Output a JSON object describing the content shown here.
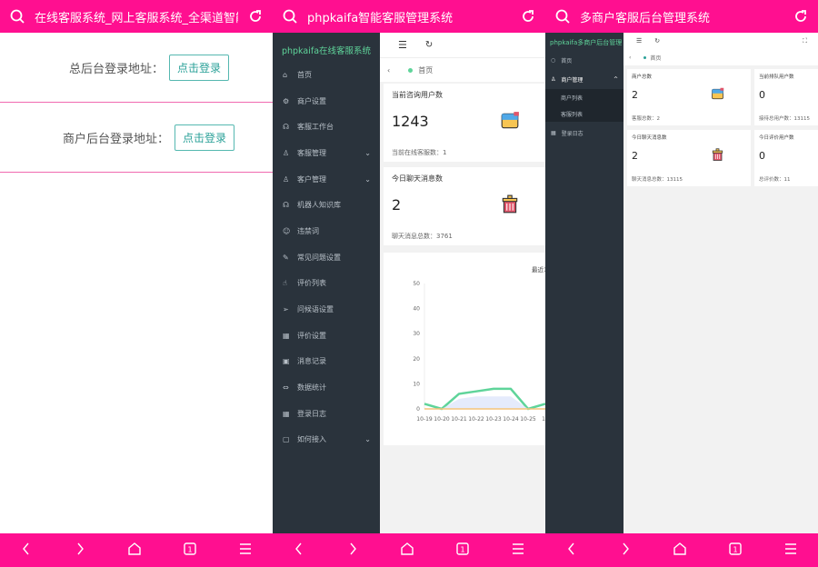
{
  "theme": {
    "browser_bar": "#ff0f90",
    "sidebar": "#2a333c",
    "accent_green": "#5fd49a",
    "button_teal": "#2aa198"
  },
  "p1": {
    "title": "在线客服系统_网上客服系统_全渠道智能客服系统",
    "rows": [
      {
        "label": "总后台登录地址：",
        "button": "点击登录"
      },
      {
        "label": "商户后台登录地址：",
        "button": "点击登录"
      }
    ]
  },
  "p2": {
    "title": "phpkaifa智能客服管理系统",
    "logo": "phpkaifa在线客服系统",
    "breadcrumb": "首页",
    "menu": [
      {
        "label": "首页",
        "icon": "home-icon"
      },
      {
        "label": "商户设置",
        "icon": "gear-icon"
      },
      {
        "label": "客服工作台",
        "icon": "headset-icon"
      },
      {
        "label": "客服管理",
        "icon": "user-icon",
        "arrow": true
      },
      {
        "label": "客户管理",
        "icon": "users-icon",
        "arrow": true
      },
      {
        "label": "机器人知识库",
        "icon": "robot-icon"
      },
      {
        "label": "违禁词",
        "icon": "smile-icon"
      },
      {
        "label": "常见问题设置",
        "icon": "edit-icon"
      },
      {
        "label": "评价列表",
        "icon": "thumb-icon"
      },
      {
        "label": "问候语设置",
        "icon": "send-icon"
      },
      {
        "label": "评价设置",
        "icon": "calendar-icon"
      },
      {
        "label": "消息记录",
        "icon": "box-icon"
      },
      {
        "label": "数据统计",
        "icon": "chart-icon"
      },
      {
        "label": "登录日志",
        "icon": "calendar-icon"
      },
      {
        "label": "如何接入",
        "icon": "link-icon",
        "arrow": true
      }
    ],
    "cards": [
      {
        "title": "当前咨询用户数",
        "value": "1243",
        "foot": "当前在线客服数：1"
      },
      {
        "title": "今日聊天消息数",
        "value": "2",
        "foot": "聊天消息总数：3761"
      }
    ]
  },
  "chart_data": {
    "type": "line",
    "title": "最近1",
    "categories": [
      "10-19",
      "10-20",
      "10-21",
      "10-22",
      "10-23",
      "10-24",
      "10-25",
      "10-26"
    ],
    "tick_labels": [
      "10-19",
      "10-20",
      "10-21",
      "10-22",
      "10-23",
      "10-24",
      "10-25",
      "10"
    ],
    "ylim": [
      0,
      50
    ],
    "yticks": [
      "0",
      "10",
      "20",
      "30",
      "40",
      "50"
    ],
    "series": [
      {
        "color": "#5fd49a",
        "values": [
          2,
          0,
          6,
          7,
          8,
          8,
          0,
          2
        ]
      },
      {
        "color": "#dfe6fb",
        "area": true,
        "values": [
          0,
          0,
          4,
          5,
          5,
          5,
          0,
          0
        ]
      },
      {
        "color": "#f5c47a",
        "values": [
          0,
          0,
          0,
          0,
          0,
          0,
          0,
          0
        ]
      }
    ]
  },
  "p3": {
    "title": "多商户客服后台管理系统",
    "logo": "phpkaifa多商户后台管理",
    "breadcrumb": "首页",
    "menu": [
      {
        "label": "首页"
      },
      {
        "label": "商户管理"
      },
      {
        "label": "商户列表"
      },
      {
        "label": "客服列表"
      },
      {
        "label": "登录日志"
      }
    ],
    "cards": [
      {
        "title": "商户总数",
        "value": "2",
        "foot": "客服总数：2"
      },
      {
        "title": "当前排队用户数",
        "value": "0",
        "foot": "接待总用户数：13115"
      },
      {
        "title": "今日聊天消息数",
        "value": "2",
        "foot": "聊天消息总数：13115"
      },
      {
        "title": "今日评价用户数",
        "value": "0",
        "foot": "总评价数：11"
      }
    ]
  }
}
